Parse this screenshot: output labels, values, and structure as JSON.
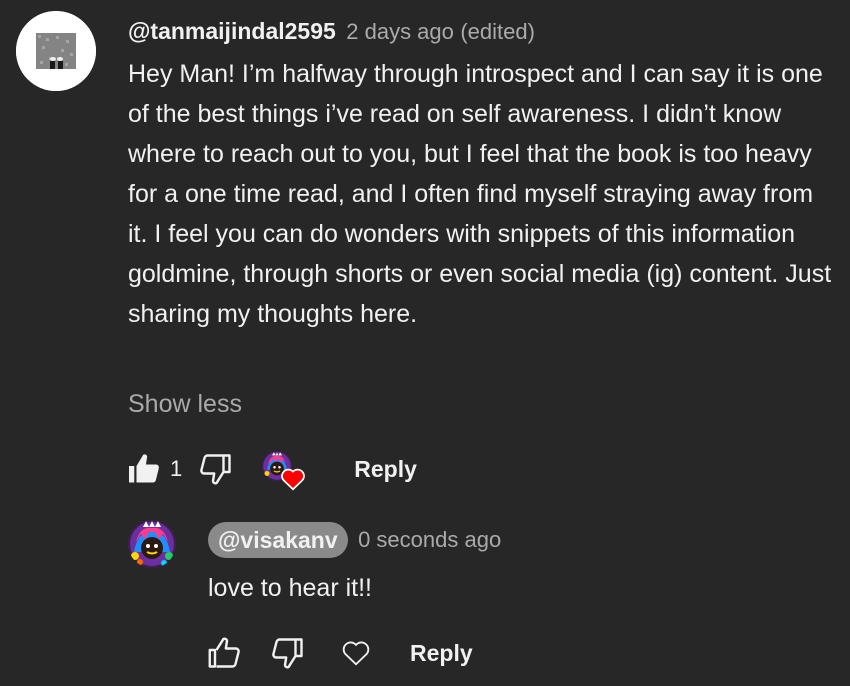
{
  "comment": {
    "author": "@tanmaijindal2595",
    "timestamp": "2 days ago",
    "edited_label": "(edited)",
    "text": "Hey Man! I’m halfway through introspect and I can say it is one of the best things i’ve read on self awareness. I didn’t know where to reach out to you, but I feel that the book is too heavy for a one time read, and I often find myself straying away from it. I feel you can do wonders with snippets of this information goldmine, through shorts or even social media (ig) content. Just sharing my thoughts here.",
    "show_less_label": "Show less",
    "like_count": "1",
    "reply_label": "Reply",
    "creator_heart": true
  },
  "reply": {
    "author": "@visakanv",
    "timestamp": "0 seconds ago",
    "text": "love to hear it!!",
    "reply_label": "Reply"
  },
  "icons": {
    "like_filled": "thumbs-up-filled-icon",
    "dislike": "thumbs-down-outline-icon",
    "like_outline": "thumbs-up-outline-icon",
    "heart_outline": "heart-outline-icon",
    "creator_heart": "red-heart-icon"
  },
  "colors": {
    "background": "#272727",
    "text_primary": "#f1f1f1",
    "text_secondary": "#aaaaaa",
    "author_chip": "#8a8a8a",
    "heart": "#ff0000"
  }
}
